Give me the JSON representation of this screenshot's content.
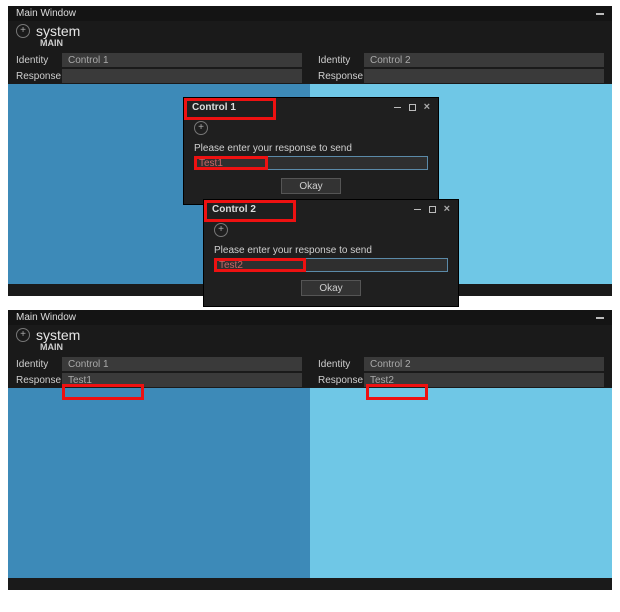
{
  "shot1": {
    "title": "Main Window",
    "system": "system",
    "main_label": "MAIN",
    "left": {
      "identity_label": "Identity",
      "identity": "Control 1",
      "response_label": "Response",
      "response": ""
    },
    "right": {
      "identity_label": "Identity",
      "identity": "Control 2",
      "response_label": "Response",
      "response": ""
    },
    "dialog1": {
      "title": "Control 1",
      "prompt": "Please enter your response to send",
      "value": "Test1",
      "okay": "Okay"
    },
    "dialog2": {
      "title": "Control 2",
      "prompt": "Please enter your response to send",
      "value": "Test2",
      "okay": "Okay"
    }
  },
  "shot2": {
    "title": "Main Window",
    "system": "system",
    "main_label": "MAIN",
    "left": {
      "identity_label": "Identity",
      "identity": "Control 1",
      "response_label": "Response",
      "response": "Test1"
    },
    "right": {
      "identity_label": "Identity",
      "identity": "Control 2",
      "response_label": "Response",
      "response": "Test2"
    }
  }
}
